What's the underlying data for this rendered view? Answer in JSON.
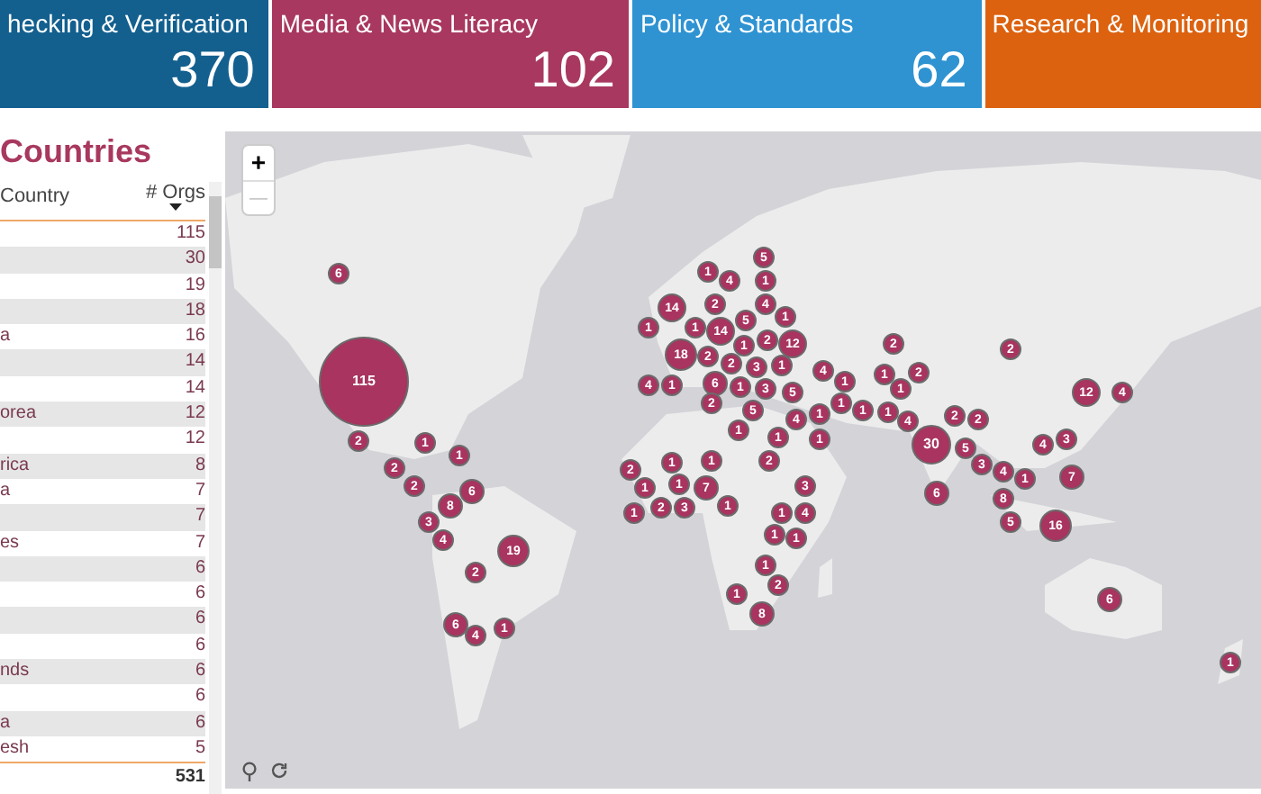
{
  "cards": [
    {
      "title": "hecking & Verification",
      "value": "370",
      "color": "#13608f"
    },
    {
      "title": "Media & News Literacy",
      "value": "102",
      "color": "#a8385f"
    },
    {
      "title": "Policy & Standards",
      "value": "62",
      "color": "#2f93d2"
    },
    {
      "title": "Research & Monitoring",
      "color": "#dc620f"
    }
  ],
  "countries": {
    "title": "Countries",
    "columns": [
      "Country",
      "# Orgs"
    ],
    "rows": [
      {
        "country": "",
        "orgs": "115"
      },
      {
        "country": "",
        "orgs": "30"
      },
      {
        "country": "",
        "orgs": "19"
      },
      {
        "country": "",
        "orgs": "18"
      },
      {
        "country": "a",
        "orgs": "16"
      },
      {
        "country": "",
        "orgs": "14"
      },
      {
        "country": "",
        "orgs": "14"
      },
      {
        "country": "orea",
        "orgs": "12"
      },
      {
        "country": "",
        "orgs": "12"
      },
      {
        "country": "rica",
        "orgs": "8"
      },
      {
        "country": "a",
        "orgs": "7"
      },
      {
        "country": "",
        "orgs": "7"
      },
      {
        "country": "es",
        "orgs": "7"
      },
      {
        "country": "",
        "orgs": "6"
      },
      {
        "country": "",
        "orgs": "6"
      },
      {
        "country": "",
        "orgs": "6"
      },
      {
        "country": "",
        "orgs": "6"
      },
      {
        "country": "nds",
        "orgs": "6"
      },
      {
        "country": "",
        "orgs": "6"
      },
      {
        "country": "a",
        "orgs": "6"
      },
      {
        "country": "esh",
        "orgs": "5"
      }
    ],
    "total": "531"
  },
  "map": {
    "zoom_in": "+",
    "zoom_out": "—",
    "markers": [
      "5",
      "6",
      "1",
      "4",
      "1",
      "14",
      "2",
      "5",
      "4",
      "1",
      "1",
      "18",
      "1",
      "2",
      "14",
      "1",
      "2",
      "12",
      "2",
      "2",
      "2",
      "3",
      "1",
      "4",
      "1",
      "2",
      "115",
      "4",
      "1",
      "6",
      "1",
      "3",
      "1",
      "1",
      "5",
      "12",
      "4",
      "2",
      "1",
      "5",
      "1",
      "1",
      "1",
      "4",
      "4",
      "2",
      "2",
      "2",
      "1",
      "1",
      "1",
      "1",
      "30",
      "5",
      "4",
      "3",
      "2",
      "1",
      "2",
      "1",
      "1",
      "2",
      "3",
      "4",
      "2",
      "6",
      "1",
      "1",
      "7",
      "3",
      "6",
      "1",
      "7",
      "8",
      "1",
      "2",
      "3",
      "1",
      "1",
      "4",
      "8",
      "3",
      "4",
      "1",
      "1",
      "5",
      "16",
      "19",
      "2",
      "1",
      "1",
      "2",
      "6",
      "4",
      "1",
      "8",
      "6",
      "1"
    ]
  }
}
